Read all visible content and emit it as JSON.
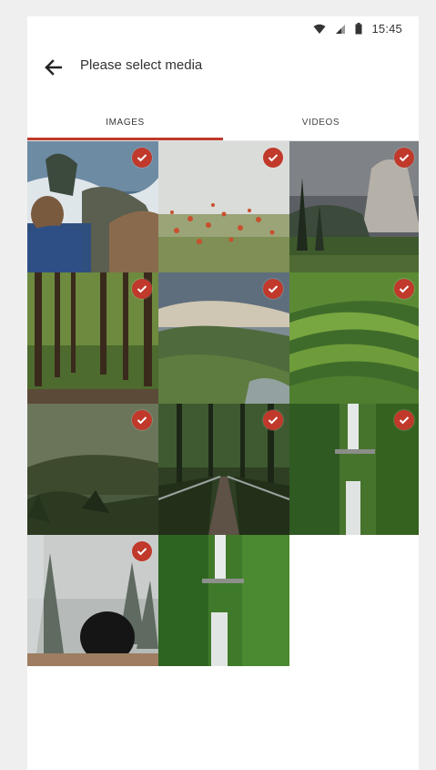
{
  "status_bar": {
    "time": "15:45",
    "icons": [
      "wifi-icon",
      "signal-icon",
      "battery-icon"
    ]
  },
  "app_bar": {
    "title": "Please select media",
    "back_icon": "arrow-left-icon"
  },
  "tabs": [
    {
      "label": "IMAGES",
      "active": true
    },
    {
      "label": "VIDEOS",
      "active": false
    }
  ],
  "accent_color": "#c0392b",
  "media": [
    {
      "name": "thumb-hiker-coast",
      "selected": true
    },
    {
      "name": "thumb-poppy-field",
      "selected": true
    },
    {
      "name": "thumb-valley-cliff",
      "selected": true
    },
    {
      "name": "thumb-forest-path",
      "selected": true
    },
    {
      "name": "thumb-misty-hills",
      "selected": true
    },
    {
      "name": "thumb-green-terraces",
      "selected": true
    },
    {
      "name": "thumb-foggy-hills",
      "selected": true
    },
    {
      "name": "thumb-forest-bridge",
      "selected": true
    },
    {
      "name": "thumb-waterfall",
      "selected": true
    },
    {
      "name": "thumb-snowy-forest-person",
      "selected": true
    },
    {
      "name": "thumb-waterfall-2",
      "selected": false
    }
  ]
}
